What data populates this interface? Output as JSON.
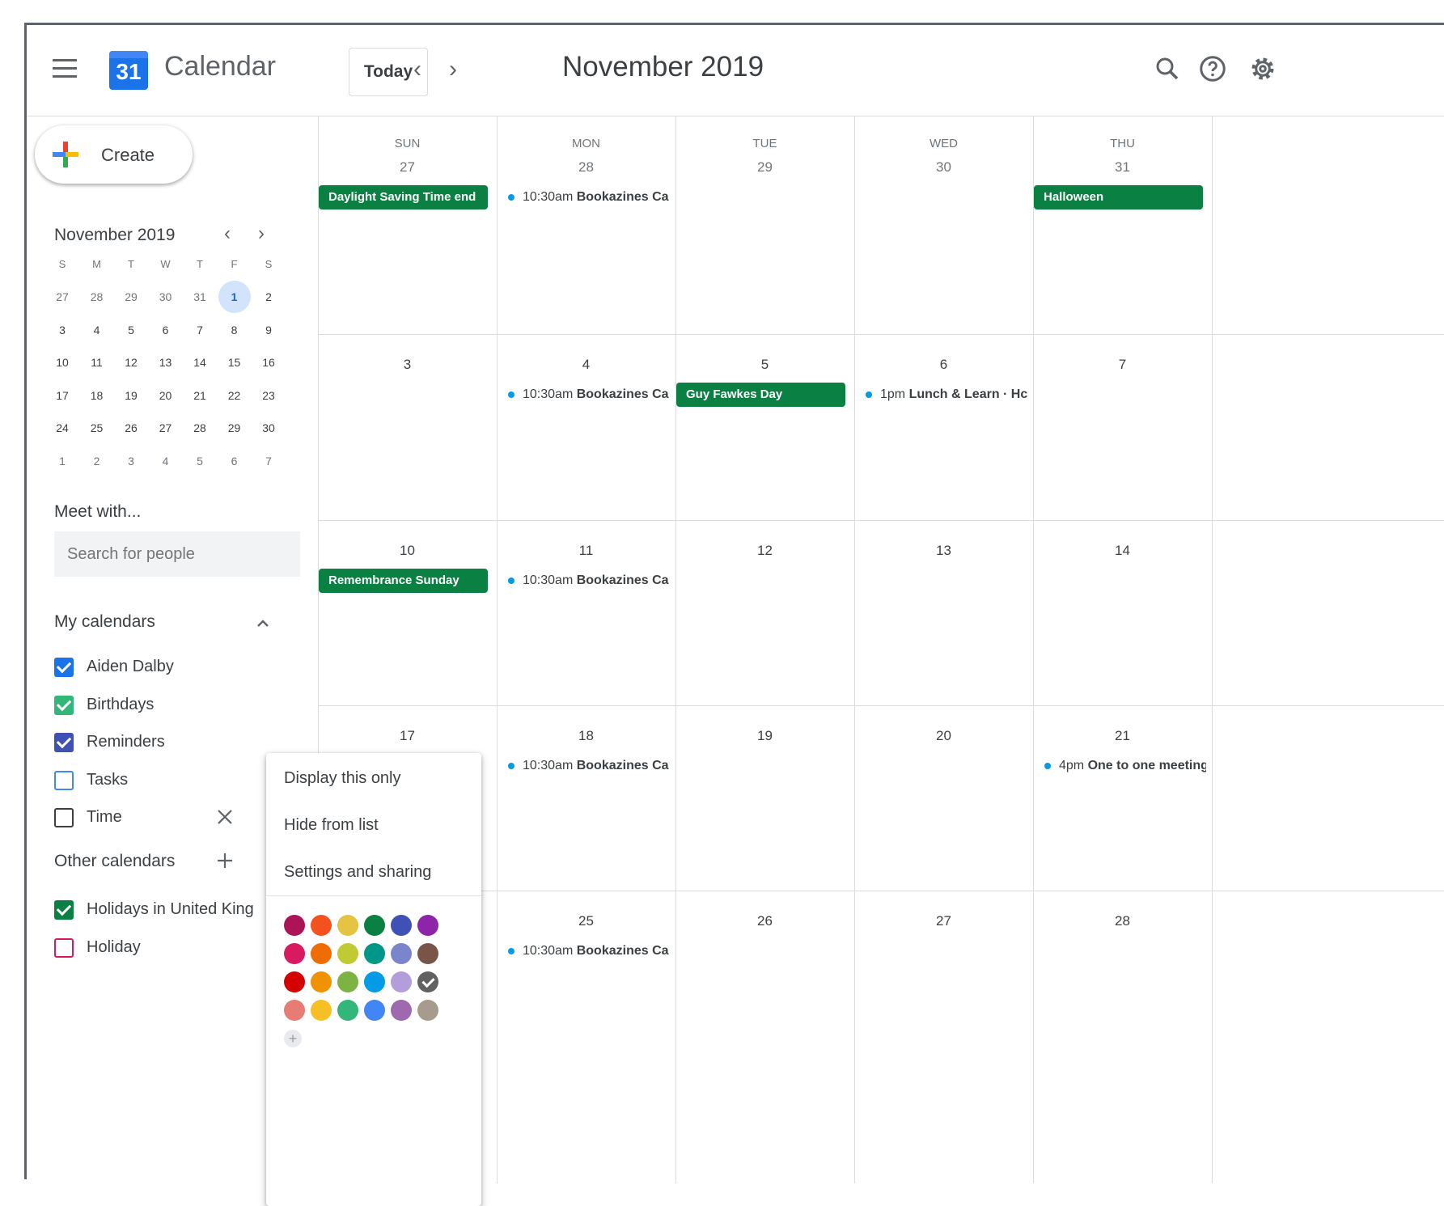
{
  "header": {
    "app_title": "Calendar",
    "logo_number": "31",
    "today_label": "Today",
    "prev_icon": "‹",
    "next_icon": "›",
    "month_title": "November 2019"
  },
  "sidebar": {
    "create_label": "Create",
    "mini_calendar": {
      "title": "November 2019",
      "prev": "‹",
      "next": "›",
      "weekdays": [
        "S",
        "M",
        "T",
        "W",
        "T",
        "F",
        "S"
      ],
      "weeks": [
        [
          "27",
          "28",
          "29",
          "30",
          "31",
          "1",
          "2"
        ],
        [
          "3",
          "4",
          "5",
          "6",
          "7",
          "8",
          "9"
        ],
        [
          "10",
          "11",
          "12",
          "13",
          "14",
          "15",
          "16"
        ],
        [
          "17",
          "18",
          "19",
          "20",
          "21",
          "22",
          "23"
        ],
        [
          "24",
          "25",
          "26",
          "27",
          "28",
          "29",
          "30"
        ],
        [
          "1",
          "2",
          "3",
          "4",
          "5",
          "6",
          "7"
        ]
      ],
      "today": "1"
    },
    "meet_title": "Meet with...",
    "search_placeholder": "Search for people",
    "my_calendars_title": "My calendars",
    "my_calendars": [
      {
        "name": "Aiden Dalby",
        "color": "#1a73e8",
        "checked": true
      },
      {
        "name": "Birthdays",
        "color": "#33b679",
        "checked": true
      },
      {
        "name": "Reminders",
        "color": "#3f51b5",
        "checked": true
      },
      {
        "name": "Tasks",
        "color": "#4285f4",
        "checked": false
      },
      {
        "name": "Time",
        "color": "#3c4043",
        "checked": false
      }
    ],
    "other_calendars_title": "Other calendars",
    "other_calendars": [
      {
        "name": "Holidays in United King",
        "color": "#0b8043",
        "checked": true
      },
      {
        "name": "Holiday",
        "color": "#d81b60",
        "checked": false
      }
    ]
  },
  "grid": {
    "weekday_heads": [
      "SUN",
      "MON",
      "TUE",
      "WED",
      "THU"
    ],
    "weeks": [
      [
        "27",
        "28",
        "29",
        "30",
        "31"
      ],
      [
        "3",
        "4",
        "5",
        "6",
        "7"
      ],
      [
        "10",
        "11",
        "12",
        "13",
        "14"
      ],
      [
        "17",
        "18",
        "19",
        "20",
        "21"
      ],
      [
        "",
        "25",
        "26",
        "27",
        "28"
      ]
    ],
    "all_day_events": [
      {
        "title": "Daylight Saving Time end",
        "week": 0,
        "day": 0
      },
      {
        "title": "Halloween",
        "week": 0,
        "day": 4
      },
      {
        "title": "Guy Fawkes Day",
        "week": 1,
        "day": 2
      },
      {
        "title": "Remembrance Sunday",
        "week": 2,
        "day": 0
      }
    ],
    "timed_events": [
      {
        "time": "10:30am",
        "title": "Bookazines Ca",
        "week": 0,
        "day": 1
      },
      {
        "time": "10:30am",
        "title": "Bookazines Ca",
        "week": 1,
        "day": 1
      },
      {
        "time": "1pm",
        "title": "Lunch & Learn · Hc",
        "week": 1,
        "day": 3
      },
      {
        "time": "10:30am",
        "title": "Bookazines Ca",
        "week": 2,
        "day": 1
      },
      {
        "time": "10:30am",
        "title": "Bookazines Ca",
        "week": 3,
        "day": 1
      },
      {
        "time": "4pm",
        "title": "One to one meeting",
        "week": 3,
        "day": 4
      },
      {
        "time": "10:30am",
        "title": "Bookazines Ca",
        "week": 4,
        "day": 1
      }
    ]
  },
  "context_menu": {
    "display_only": "Display this only",
    "hide_from_list": "Hide from list",
    "settings_sharing": "Settings and sharing",
    "add_color": "+",
    "colors": [
      [
        "#ad1457",
        "#f4511e",
        "#e4c441",
        "#0b8043",
        "#3f51b5",
        "#8e24aa"
      ],
      [
        "#d81b60",
        "#ef6c00",
        "#c0ca33",
        "#009688",
        "#7986cb",
        "#795548"
      ],
      [
        "#d50000",
        "#f09300",
        "#7cb342",
        "#039be5",
        "#b39ddb",
        "#616161"
      ],
      [
        "#e67c73",
        "#f6bf26",
        "#33b679",
        "#4285f4",
        "#9e69af",
        "#a79b8e"
      ]
    ],
    "selected_color": "#616161"
  },
  "icons": {
    "search": "search-icon",
    "help": "help-icon",
    "settings": "gear-icon",
    "close": "close-icon",
    "add": "add-icon",
    "collapse": "chevron-up-icon"
  }
}
